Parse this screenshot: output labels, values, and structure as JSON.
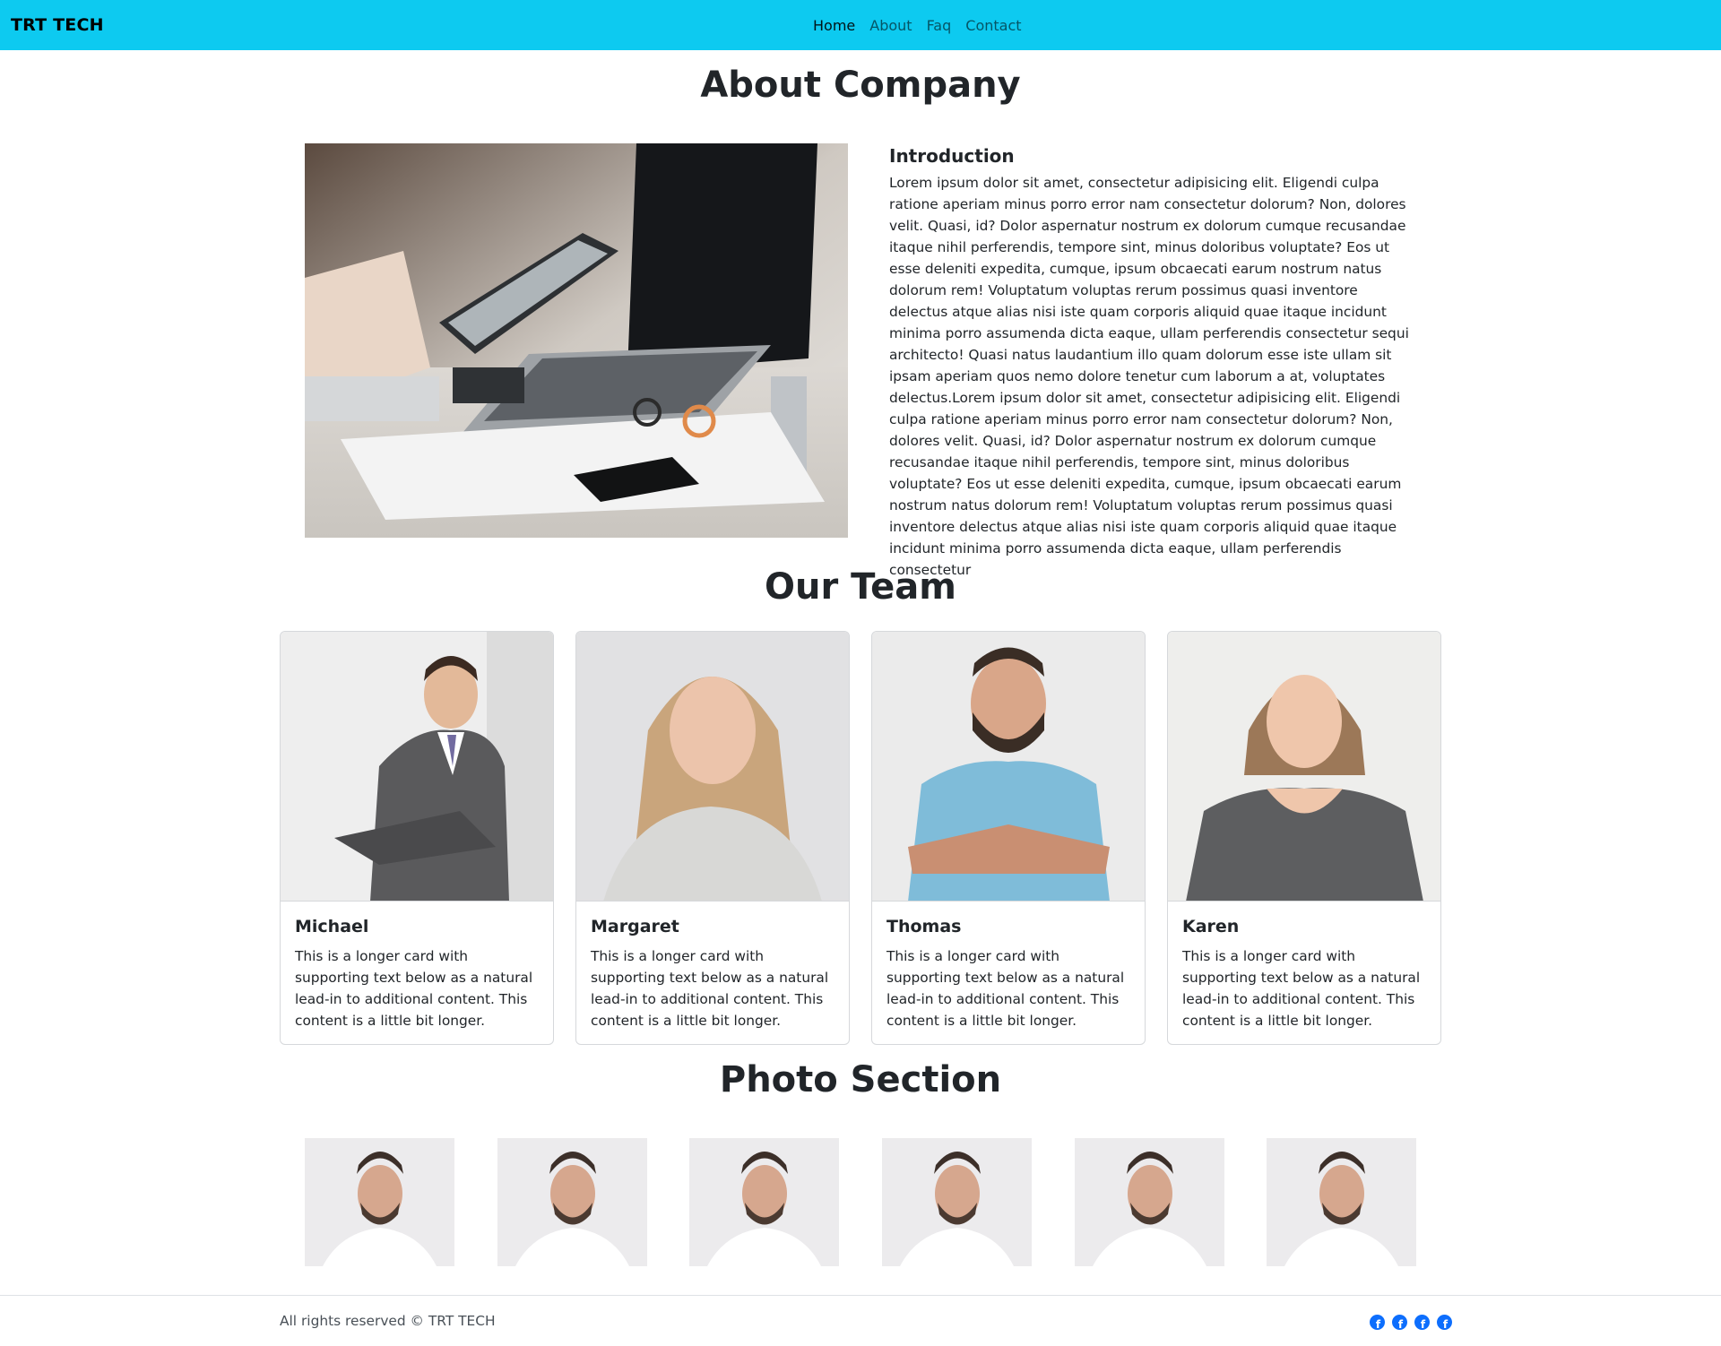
{
  "colors": {
    "navbar": "#0dcaf0",
    "text": "#212529",
    "social": "#0d6efd"
  },
  "navbar": {
    "brand": "TRT TECH",
    "links": [
      {
        "label": "Home",
        "active": true
      },
      {
        "label": "About",
        "active": false
      },
      {
        "label": "Faq",
        "active": false
      },
      {
        "label": "Contact",
        "active": false
      }
    ]
  },
  "about": {
    "title": "About Company",
    "image_icon": "office-desk-tablet-laptop-image",
    "intro_title": "Introduction",
    "intro_text": "Lorem ipsum dolor sit amet, consectetur adipisicing elit. Eligendi culpa ratione aperiam minus porro error nam consectetur dolorum? Non, dolores velit. Quasi, id? Dolor aspernatur nostrum ex dolorum cumque recusandae itaque nihil perferendis, tempore sint, minus doloribus voluptate? Eos ut esse deleniti expedita, cumque, ipsum obcaecati earum nostrum natus dolorum rem! Voluptatum voluptas rerum possimus quasi inventore delectus atque alias nisi iste quam corporis aliquid quae itaque incidunt minima porro assumenda dicta eaque, ullam perferendis consectetur sequi architecto! Quasi natus laudantium illo quam dolorum esse iste ullam sit ipsam aperiam quos nemo dolore tenetur cum laborum a at, voluptates delectus.Lorem ipsum dolor sit amet, consectetur adipisicing elit. Eligendi culpa ratione aperiam minus porro error nam consectetur dolorum? Non, dolores velit. Quasi, id? Dolor aspernatur nostrum ex dolorum cumque recusandae itaque nihil perferendis, tempore sint, minus doloribus voluptate? Eos ut esse deleniti expedita, cumque, ipsum obcaecati earum nostrum natus dolorum rem! Voluptatum voluptas rerum possimus quasi inventore delectus atque alias nisi iste quam corporis aliquid quae itaque incidunt minima porro assumenda dicta eaque, ullam perferendis consectetur"
  },
  "team": {
    "title": "Our Team",
    "members": [
      {
        "name": "Michael",
        "text": "This is a longer card with supporting text below as a natural lead-in to additional content. This content is a little bit longer."
      },
      {
        "name": "Margaret",
        "text": "This is a longer card with supporting text below as a natural lead-in to additional content. This content is a little bit longer."
      },
      {
        "name": "Thomas",
        "text": "This is a longer card with supporting text below as a natural lead-in to additional content. This content is a little bit longer."
      },
      {
        "name": "Karen",
        "text": "This is a longer card with supporting text below as a natural lead-in to additional content. This content is a little bit longer."
      }
    ]
  },
  "photos": {
    "title": "Photo Section",
    "count": 6
  },
  "footer": {
    "copyright": "All rights reserved © TRT TECH",
    "social_icons": [
      "facebook-icon",
      "facebook-icon",
      "facebook-icon",
      "facebook-icon"
    ]
  }
}
